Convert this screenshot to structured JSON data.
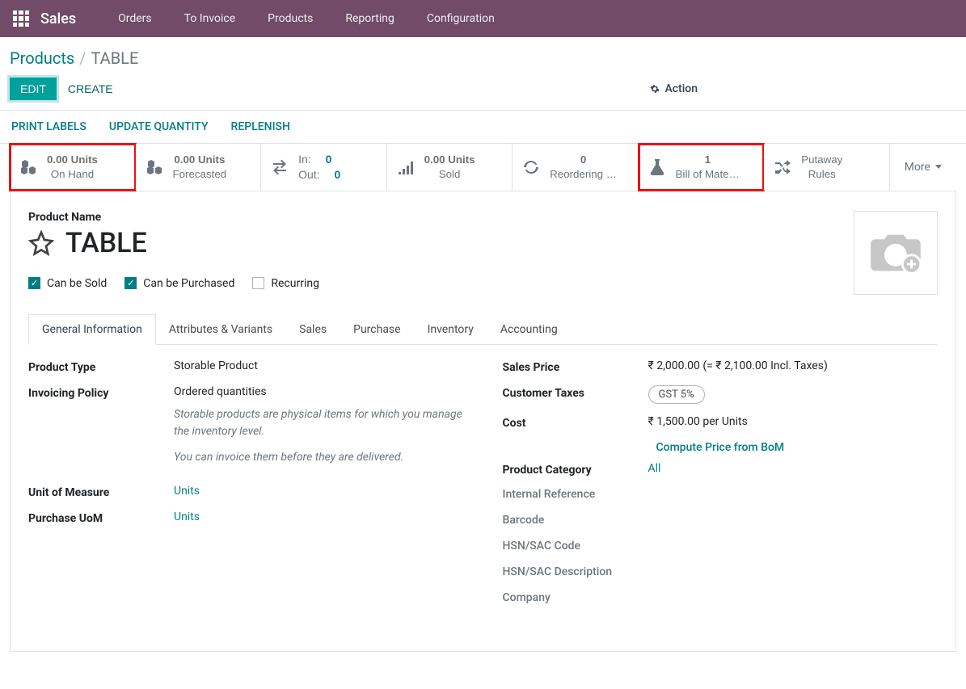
{
  "nav": {
    "app": "Sales",
    "items": [
      "Orders",
      "To Invoice",
      "Products",
      "Reporting",
      "Configuration"
    ]
  },
  "breadcrumb": {
    "parent": "Products",
    "sep": "/",
    "current": "TABLE"
  },
  "buttons": {
    "edit": "EDIT",
    "create": "CREATE",
    "action": "Action",
    "more": "More"
  },
  "sub_actions": [
    "PRINT LABELS",
    "UPDATE QUANTITY",
    "REPLENISH"
  ],
  "stats": {
    "on_hand": {
      "value": "0.00 Units",
      "label": "On Hand"
    },
    "forecasted": {
      "value": "0.00 Units",
      "label": "Forecasted"
    },
    "inout": {
      "in_label": "In:",
      "in_val": "0",
      "out_label": "Out:",
      "out_val": "0"
    },
    "sold": {
      "value": "0.00 Units",
      "label": "Sold"
    },
    "reorder": {
      "value": "0",
      "label": "Reordering …"
    },
    "bom": {
      "value": "1",
      "label": "Bill of Mate…"
    },
    "putaway": {
      "value": "Putaway",
      "label": "Rules"
    }
  },
  "form": {
    "pn_label": "Product Name",
    "pn_value": "TABLE",
    "chk_sold": "Can be Sold",
    "chk_purchased": "Can be Purchased",
    "chk_recurring": "Recurring"
  },
  "tabs": [
    "General Information",
    "Attributes & Variants",
    "Sales",
    "Purchase",
    "Inventory",
    "Accounting"
  ],
  "general": {
    "left": {
      "product_type_l": "Product Type",
      "product_type_v": "Storable Product",
      "invoicing_l": "Invoicing Policy",
      "invoicing_v": "Ordered quantities",
      "help1": "Storable products are physical items for which you manage the inventory level.",
      "help2": "You can invoice them before they are delivered.",
      "uom_l": "Unit of Measure",
      "uom_v": "Units",
      "puom_l": "Purchase UoM",
      "puom_v": "Units"
    },
    "right": {
      "sp_l": "Sales Price",
      "sp_v": "₹ 2,000.00  (= ₹ 2,100.00 Incl. Taxes)",
      "ct_l": "Customer Taxes",
      "ct_v": "GST 5%",
      "cost_l": "Cost",
      "cost_v": "₹ 1,500.00  per Units",
      "compute": "Compute Price from BoM",
      "pc_l": "Product Category",
      "pc_v": "All",
      "ir_l": "Internal Reference",
      "bc_l": "Barcode",
      "hsn_l": "HSN/SAC Code",
      "hsnd_l": "HSN/SAC Description",
      "co_l": "Company"
    }
  }
}
